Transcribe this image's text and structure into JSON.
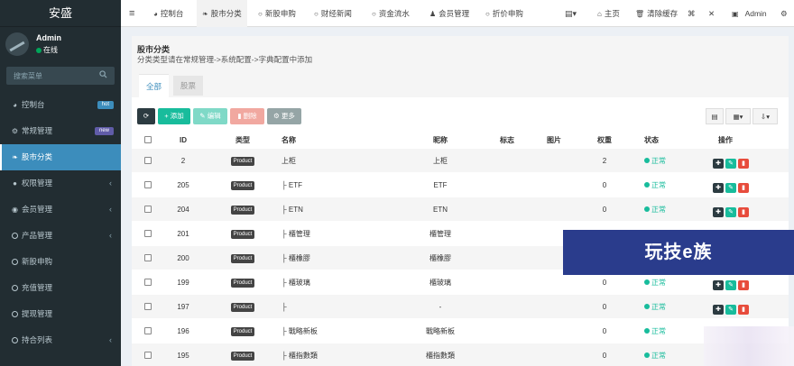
{
  "app": {
    "title": "安盛"
  },
  "user": {
    "name": "Admin",
    "status": "在线"
  },
  "search": {
    "placeholder": "搜索菜单"
  },
  "menu": [
    {
      "label": "控制台",
      "icon": "dashboard-icon",
      "badge": "hot",
      "badge_color": "#3c8dbc"
    },
    {
      "label": "常规管理",
      "icon": "cogs-icon",
      "badge": "new",
      "badge_color": "#605ca8"
    },
    {
      "label": "股市分类",
      "icon": "leaf-icon",
      "active": true
    },
    {
      "label": "权限管理",
      "icon": "users-icon",
      "caret": "‹"
    },
    {
      "label": "会员管理",
      "icon": "user-circle-icon",
      "caret": "‹"
    },
    {
      "label": "产品管理",
      "icon": "circle-icon",
      "caret": "‹"
    },
    {
      "label": "新股申购",
      "icon": "circle-icon"
    },
    {
      "label": "充值管理",
      "icon": "circle-icon"
    },
    {
      "label": "提现管理",
      "icon": "circle-icon"
    },
    {
      "label": "持合列表",
      "icon": "circle-icon",
      "caret": "‹"
    }
  ],
  "topbar": {
    "tabs": [
      {
        "label": "控制台",
        "icon": "dashboard-icon"
      },
      {
        "label": "股市分类",
        "icon": "leaf-icon",
        "active": true
      },
      {
        "label": "新股申购",
        "icon": "circle-icon"
      },
      {
        "label": "财经新闻",
        "icon": "circle-icon"
      },
      {
        "label": "资金流水",
        "icon": "circle-icon"
      },
      {
        "label": "会员管理",
        "icon": "user-icon"
      },
      {
        "label": "折价申购",
        "icon": "circle-icon"
      }
    ],
    "home": "主页",
    "clear_cache": "清除缓存",
    "admin": "Admin"
  },
  "panel": {
    "title": "股市分类",
    "subtitle": "分类类型请在常规管理->系统配置->字典配置中添加",
    "tabs": [
      "全部",
      "股票"
    ]
  },
  "toolbar": {
    "add": "添加",
    "edit": "编辑",
    "delete": "删除",
    "more": "更多"
  },
  "table": {
    "headers": {
      "id": "ID",
      "type": "类型",
      "name": "名称",
      "nickname": "昵称",
      "flag": "标志",
      "image": "图片",
      "weight": "权重",
      "status": "状态",
      "operate": "操作"
    },
    "rows": [
      {
        "id": "2",
        "type": "Product",
        "name": "上柜",
        "nickname": "上柜",
        "weight": "2",
        "status": "正常"
      },
      {
        "id": "205",
        "type": "Product",
        "name": "├ ETF",
        "nickname": "ETF",
        "weight": "0",
        "status": "正常"
      },
      {
        "id": "204",
        "type": "Product",
        "name": "├ ETN",
        "nickname": "ETN",
        "weight": "0",
        "status": "正常"
      },
      {
        "id": "201",
        "type": "Product",
        "name": "├ 櫃管理",
        "nickname": "櫃管理",
        "weight": "",
        "status": ""
      },
      {
        "id": "200",
        "type": "Product",
        "name": "├ 櫃橡膠",
        "nickname": "櫃橡膠",
        "weight": "",
        "status": ""
      },
      {
        "id": "199",
        "type": "Product",
        "name": "├ 櫃玻璃",
        "nickname": "櫃玻璃",
        "weight": "0",
        "status": "正常"
      },
      {
        "id": "197",
        "type": "Product",
        "name": "├",
        "nickname": "-",
        "weight": "0",
        "status": "正常"
      },
      {
        "id": "196",
        "type": "Product",
        "name": "├ 戰略新板",
        "nickname": "戰略新板",
        "weight": "0",
        "status": "正常"
      },
      {
        "id": "195",
        "type": "Product",
        "name": "├ 櫃指數類",
        "nickname": "櫃指數類",
        "weight": "0",
        "status": "正常"
      }
    ]
  },
  "watermark": {
    "text": "玩技e族"
  }
}
